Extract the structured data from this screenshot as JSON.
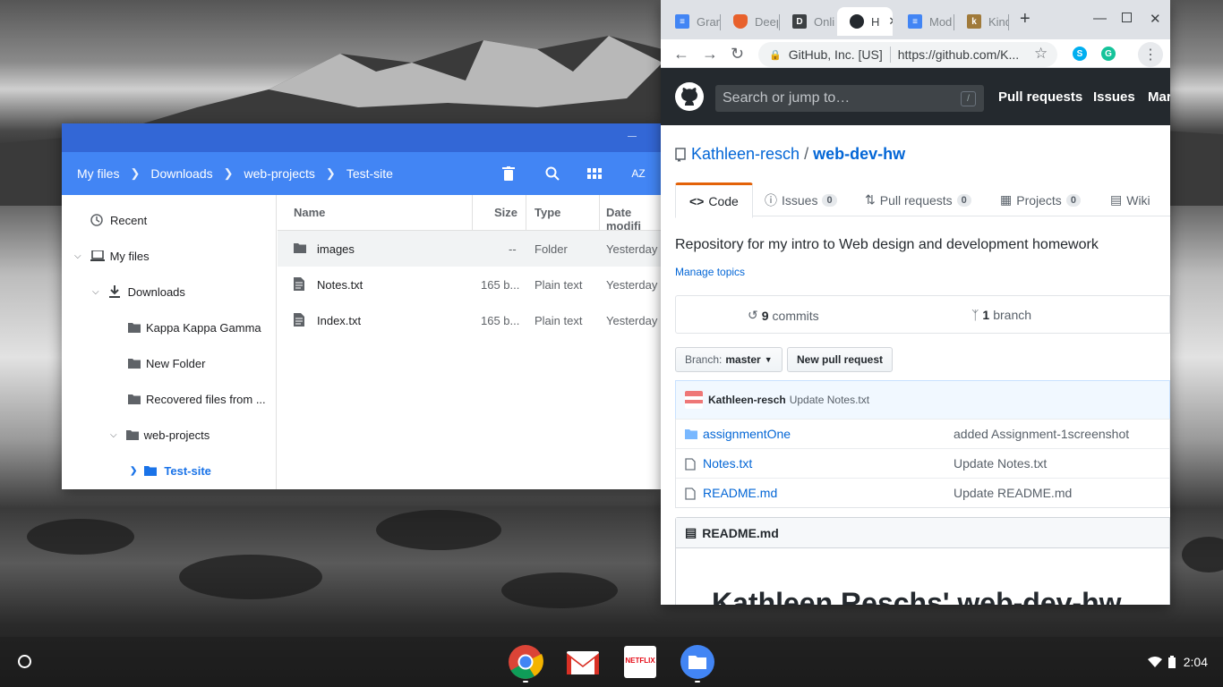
{
  "files": {
    "breadcrumb": [
      "My files",
      "Downloads",
      "web-projects",
      "Test-site"
    ],
    "sort_label": "AZ",
    "sidebar": {
      "recent": "Recent",
      "my_files": "My files",
      "downloads": "Downloads",
      "folders": [
        "Kappa Kappa Gamma",
        "New Folder",
        "Recovered files from ..."
      ],
      "web_projects": "web-projects",
      "test_site": "Test-site"
    },
    "columns": {
      "name": "Name",
      "size": "Size",
      "type": "Type",
      "date": "Date modifi"
    },
    "rows": [
      {
        "name": "images",
        "size": "--",
        "type": "Folder",
        "date": "Yesterday"
      },
      {
        "name": "Notes.txt",
        "size": "165 b...",
        "type": "Plain text",
        "date": "Yesterday"
      },
      {
        "name": "Index.txt",
        "size": "165 b...",
        "type": "Plain text",
        "date": "Yesterday"
      }
    ]
  },
  "browser": {
    "tabs": [
      "Gran",
      "Deep",
      "Onli",
      "H",
      "Mod",
      "Kind"
    ],
    "site_identity": "GitHub, Inc. [US]",
    "url": "https://github.com/K...",
    "colors": {
      "chrome_blue": "#4285f4",
      "github_dark": "#24292e",
      "link": "#0366d6",
      "accent_orange": "#e36209"
    }
  },
  "github": {
    "search_placeholder": "Search or jump to…",
    "search_key": "/",
    "nav": [
      "Pull requests",
      "Issues",
      "Mar"
    ],
    "owner": "Kathleen-resch",
    "separator": "/",
    "repo": "web-dev-hw",
    "tabs": {
      "code": "Code",
      "issues": "Issues",
      "issues_count": "0",
      "pulls": "Pull requests",
      "pulls_count": "0",
      "projects": "Projects",
      "projects_count": "0",
      "wiki": "Wiki"
    },
    "description": "Repository for my intro to Web design and development homework",
    "manage_topics": "Manage topics",
    "commits_count": "9",
    "commits_label": "commits",
    "branch_count": "1",
    "branch_label": "branch",
    "branch_prefix": "Branch:",
    "branch_name": "master",
    "new_pr": "New pull request",
    "latest_author": "Kathleen-resch",
    "latest_message": "Update Notes.txt",
    "files": [
      {
        "name": "assignmentOne",
        "message": "added Assignment-1screenshot"
      },
      {
        "name": "Notes.txt",
        "message": "Update Notes.txt"
      },
      {
        "name": "README.md",
        "message": "Update README.md"
      }
    ],
    "readme_file": "README.md",
    "readme_title": "Kathleen Reschs' web-dev-hw"
  },
  "shelf": {
    "time": "2:04",
    "apps": [
      "chrome-icon",
      "gmail-icon",
      "netflix-icon",
      "files-icon"
    ],
    "netflix_text": "NETFLIX"
  }
}
